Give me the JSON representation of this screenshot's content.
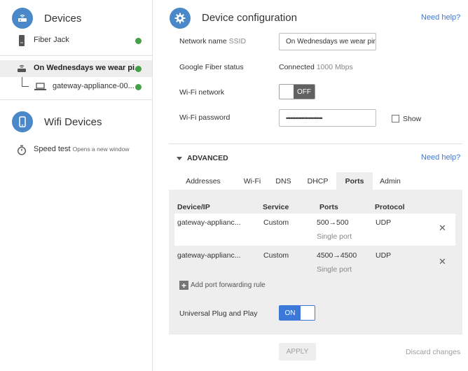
{
  "sidebar": {
    "devices_title": "Devices",
    "fiber_jack": {
      "label": "Fiber Jack",
      "status": "online"
    },
    "network_item": {
      "label": "On Wednesdays we wear pi...",
      "status": "online"
    },
    "gateway_item": {
      "label": "gateway-appliance-00...",
      "status": "online"
    },
    "wifi_devices_title": "Wifi Devices",
    "speed_test": {
      "label": "Speed test",
      "note": "Opens a new window"
    }
  },
  "header": {
    "title": "Device configuration",
    "help": "Need help?"
  },
  "form": {
    "ssid_label": "Network name",
    "ssid_sub": "SSID",
    "ssid_value": "On Wednesdays we wear pir",
    "status_label": "Google Fiber status",
    "status_value": "Connected",
    "status_speed": "1000 Mbps",
    "wifi_label": "Wi-Fi network",
    "wifi_toggle": "OFF",
    "password_label": "Wi-Fi password",
    "password_value": "••••••••••••••••••••••••",
    "show_label": "Show"
  },
  "advanced": {
    "title": "ADVANCED",
    "help": "Need help?",
    "tabs": [
      "Addresses",
      "Wi-Fi",
      "DNS",
      "DHCP",
      "Ports",
      "Admin"
    ],
    "active_tab": "Ports"
  },
  "ports": {
    "headers": [
      "Device/IP",
      "Service",
      "Ports",
      "Protocol"
    ],
    "rows": [
      {
        "device": "gateway-applianc...",
        "service": "Custom",
        "ports": "500→500",
        "ports_sub": "Single port",
        "protocol": "UDP"
      },
      {
        "device": "gateway-applianc...",
        "service": "Custom",
        "ports": "4500→4500",
        "ports_sub": "Single port",
        "protocol": "UDP"
      }
    ],
    "add_label": "Add port forwarding rule",
    "upnp_label": "Universal Plug and Play",
    "upnp_toggle": "ON"
  },
  "footer": {
    "apply": "APPLY",
    "discard": "Discard changes"
  },
  "colors": {
    "accent": "#4a88c9",
    "link": "#3b78d8",
    "online": "#43a047",
    "toggle_off": "#616161"
  }
}
